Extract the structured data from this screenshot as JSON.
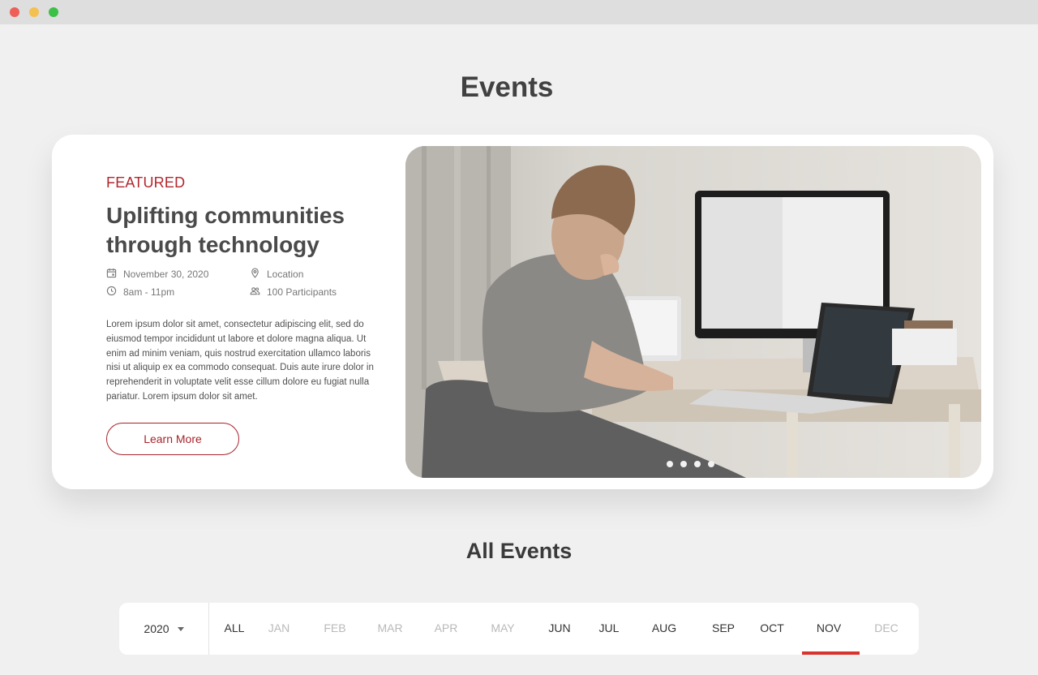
{
  "page": {
    "title": "Events"
  },
  "featured": {
    "label": "FEATURED",
    "title": "Uplifting communities through technology",
    "date": "November 30, 2020",
    "time": "8am - 11pm",
    "location": "Location",
    "participants": "100 Participants",
    "description": "Lorem ipsum dolor sit amet, consectetur adipiscing elit, sed do eiusmod tempor incididunt ut labore et dolore magna aliqua. Ut enim ad minim veniam, quis nostrud exercitation ullamco laboris nisi ut aliquip ex ea commodo consequat. Duis aute irure dolor in reprehenderit in voluptate velit esse cillum dolore eu fugiat nulla pariatur. Lorem ipsum dolor sit amet.",
    "button_label": "Learn More",
    "carousel_dot_count": 4
  },
  "all_events": {
    "title": "All Events",
    "year": "2020",
    "months": [
      {
        "label": "ALL",
        "enabled": true
      },
      {
        "label": "JAN",
        "enabled": false
      },
      {
        "label": "FEB",
        "enabled": false
      },
      {
        "label": "MAR",
        "enabled": false
      },
      {
        "label": "APR",
        "enabled": false
      },
      {
        "label": "MAY",
        "enabled": false
      },
      {
        "label": "JUN",
        "enabled": true
      },
      {
        "label": "JUL",
        "enabled": true
      },
      {
        "label": "AUG",
        "enabled": true
      },
      {
        "label": "SEP",
        "enabled": true
      },
      {
        "label": "OCT",
        "enabled": true
      },
      {
        "label": "NOV",
        "enabled": true,
        "selected": true
      },
      {
        "label": "DEC",
        "enabled": false
      }
    ]
  },
  "colors": {
    "accent": "#b3262e",
    "selected_underline": "#d8332e",
    "background": "#f0f0f0"
  }
}
